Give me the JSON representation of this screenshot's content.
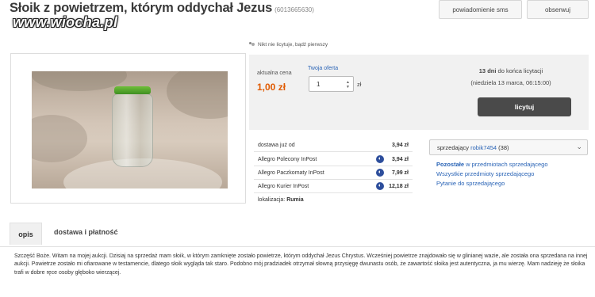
{
  "header": {
    "title": "Słoik z powietrzem, którym oddychał Jezus",
    "offer_id": "(6013665630)",
    "watermark": "www.wiocha.pl",
    "sms_button": "powiadomienie sms",
    "watch_button": "obserwuj"
  },
  "bid_info": {
    "no_bids": "Nikt nie licytuje, bądź pierwszy",
    "current_price_label": "aktualna cena",
    "current_price": "1,00 zł",
    "your_offer_label": "Twoja oferta",
    "offer_value": "1",
    "currency": "zł",
    "days_left_bold": "13 dni",
    "days_left_rest": " do końca licytacji",
    "end_date": "(niedziela 13 marca, 06:15:00)",
    "bid_button": "licytuj"
  },
  "shipping": {
    "label": "dostawa już od",
    "from_price": "3,94 zł",
    "options": [
      {
        "name": "Allegro Polecony InPost",
        "price": "3,94 zł"
      },
      {
        "name": "Allegro Paczkomaty InPost",
        "price": "7,99 zł"
      },
      {
        "name": "Allegro Kurier InPost",
        "price": "12,18 zł"
      }
    ],
    "location_label": "lokalizacja:",
    "location": "Rumia"
  },
  "seller": {
    "label": "sprzedający",
    "nick": "robik7454",
    "rating": "(38)",
    "link_other_bold": "Pozostałe",
    "link_other_rest": " w przedmiotach sprzedającego",
    "link_all": "Wszystkie przedmioty sprzedającego",
    "link_ask": "Pytanie do sprzedającego"
  },
  "tabs": {
    "description": "opis",
    "shipping": "dostawa i płatność"
  },
  "description": "Szczęść Boże. Witam na mojej aukcji. Dzisiaj na sprzedaż mam słoik, w którym zamknięte zostało powietrze, którym oddychał Jezus Chrystus. Wcześniej powietrze znajdowało się w glinianej wazie, ale została ona sprzedana na innej aukcji. Powietrze zostało mi ofiarowane w testamencie, dlatego słoik wygląda tak staro. Podobno mój pradziadek otrzymał słowną przysięgę dwunastu osób, że zawartość słoika jest autentyczna, ja mu wierzę. Mam nadzieję że słoika trafi w dobre ręce osoby głęboko wierzącej.",
  "colors": {
    "price": "#e05a00",
    "link": "#2a64b6",
    "button_dark": "#4a4a4a",
    "inpost_icon": "#2d4e9c"
  }
}
